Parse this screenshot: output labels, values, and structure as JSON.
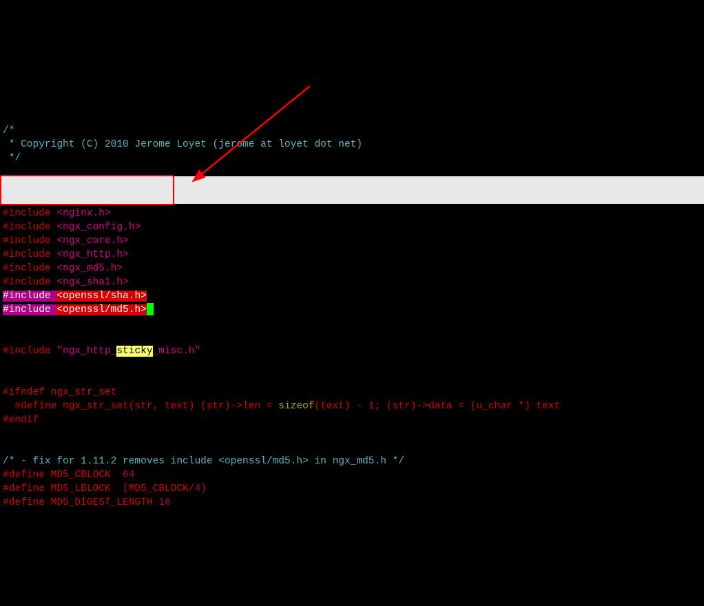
{
  "code": {
    "c1": "/*",
    "c2": " * Copyright (C) 2010 Jerome Loyet (jerome at loyet dot net)",
    "c3": " */",
    "inc1_dir": "#include ",
    "inc1_hdr": "<nginx.h>",
    "inc2_dir": "#include ",
    "inc2_hdr": "<ngx_config.h>",
    "inc3_dir": "#include ",
    "inc3_hdr": "<ngx_core.h>",
    "inc4_dir": "#include ",
    "inc4_hdr": "<ngx_http.h>",
    "inc5_dir": "#include ",
    "inc5_hdr": "<ngx_md5.h>",
    "inc6_dir": "#include ",
    "inc6_hdr": "<ngx_sha1.h>",
    "inc7_dir": "#include ",
    "inc7_hdr": "<openssl/sha.h>",
    "inc8_dir": "#include ",
    "inc8_hdr": "<openssl/md5.h>",
    "inc9_dir": "#include ",
    "inc9_pre": "\"ngx_http_",
    "inc9_hl": "sticky",
    "inc9_post": "_misc.h\"",
    "ifndef": "#ifndef ngx_str_set",
    "def_line_indent": "  ",
    "def1": "#define ngx_str_set(str, text) (str)->len = ",
    "sizeof": "sizeof",
    "def1b": "(text) - ",
    "one": "1",
    "def1c": "; (str)->data = (u_char *) text",
    "endif": "#endif",
    "fixcmt": "/* - fix for 1.11.2 removes include <openssl/md5.h> in ngx_md5.h */",
    "def2": "#define MD5_CBLOCK  ",
    "def2v": "64",
    "def3": "#define MD5_LBLOCK  (MD5_CBLOCK/",
    "def3v": "4",
    "def3c": ")",
    "def4": "#define MD5_DIGEST_LENGTH ",
    "def4v": "16"
  }
}
